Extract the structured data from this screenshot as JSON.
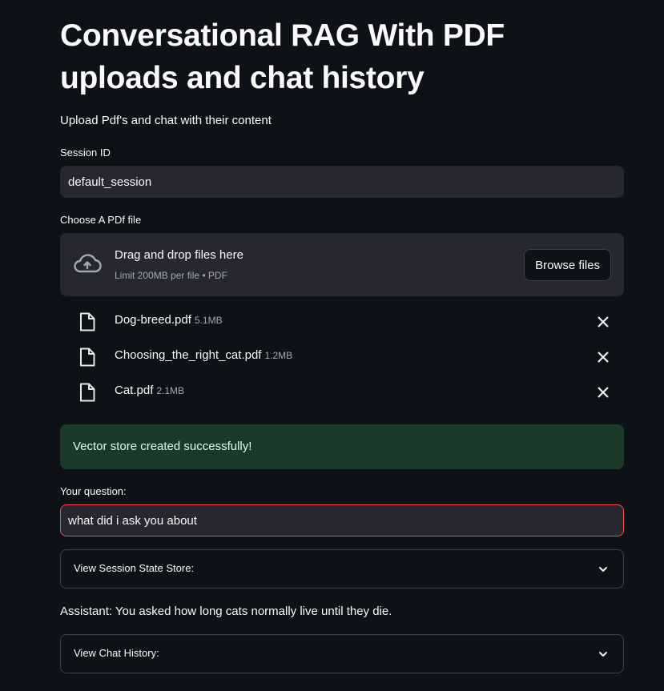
{
  "page": {
    "title": "Conversational RAG With PDF uploads and chat history",
    "subtitle": "Upload Pdf's and chat with their content"
  },
  "session": {
    "label": "Session ID",
    "value": "default_session"
  },
  "uploader": {
    "label": "Choose A PDf file",
    "drop_title": "Drag and drop files here",
    "limit": "Limit 200MB per file • PDF",
    "browse_label": "Browse files",
    "files": [
      {
        "name": "Dog-breed.pdf",
        "size": "5.1MB"
      },
      {
        "name": "Choosing_the_right_cat.pdf",
        "size": "1.2MB"
      },
      {
        "name": "Cat.pdf",
        "size": "2.1MB"
      }
    ]
  },
  "status": {
    "message": "Vector store created successfully!"
  },
  "question": {
    "label": "Your question:",
    "value": "what did i ask you about"
  },
  "expanders": {
    "session_state": "View Session State Store:",
    "chat_history": "View Chat History:"
  },
  "assistant": {
    "response": "Assistant: You asked how long cats normally live until they die."
  },
  "colors": {
    "background": "#0e1117",
    "widget": "#262730",
    "focus_border": "#ff4b4b",
    "success_bg": "#1c3a2a",
    "success_text": "#dffde9"
  },
  "icons": {
    "upload": "cloud-upload-icon",
    "file": "file-icon",
    "remove": "close-icon",
    "expand": "chevron-down-icon"
  }
}
